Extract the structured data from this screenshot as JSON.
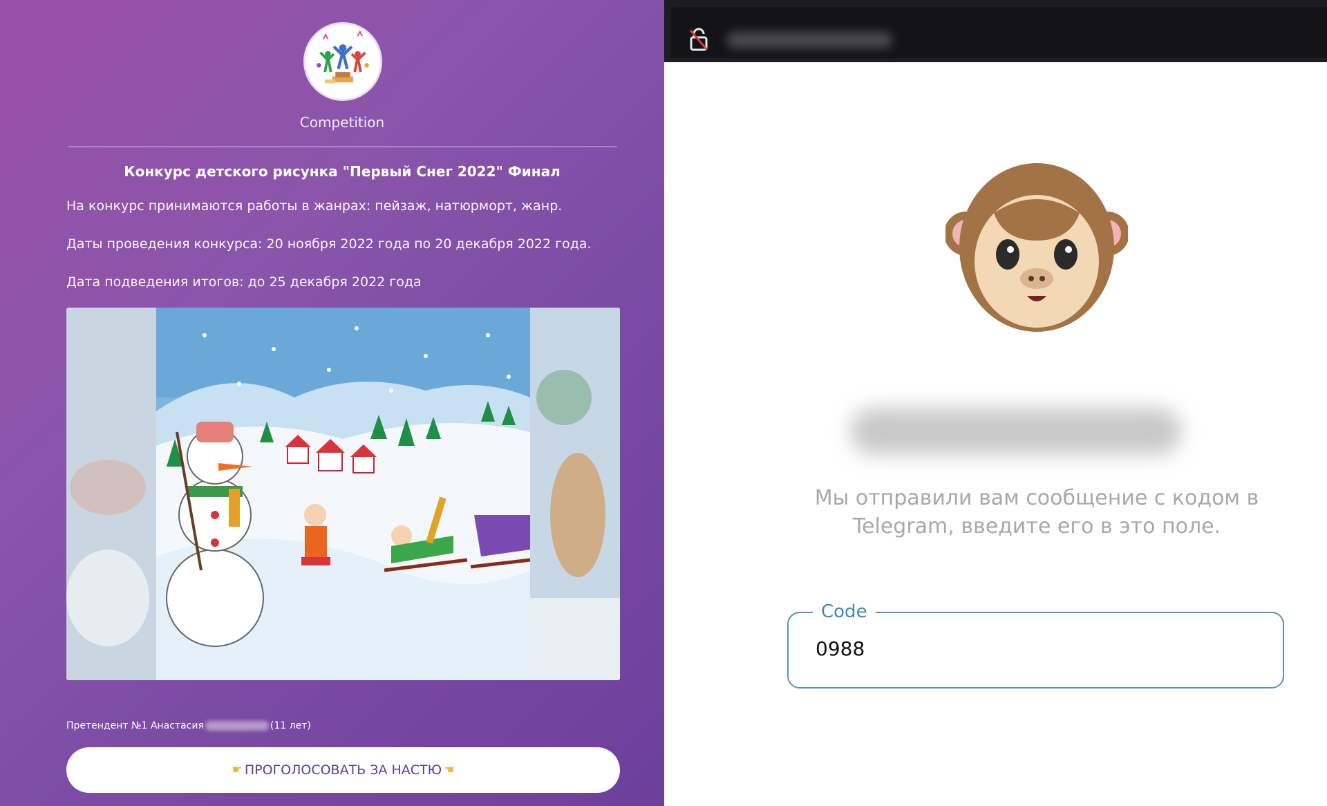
{
  "left_site": {
    "brand": "Competition",
    "title": "Конкурс детского рисунка \"Первый Снег 2022\" Финал",
    "paragraphs": [
      "На конкурс принимаются работы в жанрах: пейзаж, натюрморт, жанр.",
      "Даты проведения конкурса: 20 ноября 2022 года по 20 декабря 2022 года.",
      "Дата подведения итогов: до 25 декабря 2022 года"
    ],
    "candidate_prefix": "Претендент №1 Анастасия",
    "candidate_suffix": "(11 лет)",
    "vote_button": "ПРОГОЛОСОВАТЬ ЗА НАСТЮ",
    "logo_icon": "colorful-people-on-podium-logo",
    "image_subject": "children's drawing: snowman, sledding children, snowy village"
  },
  "right_site": {
    "lock_icon": "broken-lock-icon",
    "mascot_icon": "monkey-face-icon",
    "hint_line1": "Мы отправили вам сообщение с кодом в",
    "hint_line2": "Telegram, введите его в это поле.",
    "code_label": "Code",
    "code_value": "0988"
  },
  "colors": {
    "left_bg": "#8a55ab",
    "button_text": "#5b3aa6",
    "field_border": "#4d93c4",
    "hint_text": "#a8a8a8"
  }
}
